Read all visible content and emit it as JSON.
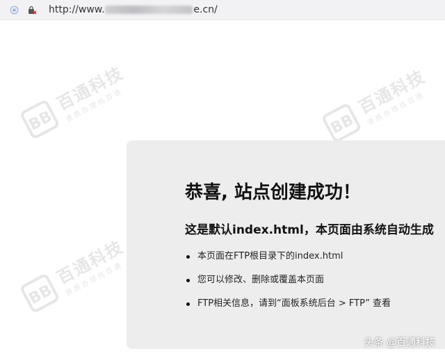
{
  "browser": {
    "url_prefix": "http://www.",
    "url_suffix": "e.cn/"
  },
  "watermark": {
    "name": "百通科技",
    "slogan": "贤质办理找百通",
    "logo_text": "BB"
  },
  "page": {
    "title": "恭喜, 站点创建成功！",
    "subtitle": "这是默认index.html，本页面由系统自动生成",
    "bullets": [
      "本页面在FTP根目录下的index.html",
      "您可以修改、删除或覆盖本页面",
      "FTP相关信息，请到“面板系统后台 > FTP” 查看"
    ]
  },
  "caption": "头条 @百通科技",
  "colors": {
    "card_bg": "#ededee",
    "addr_bg": "#f2f2f4"
  }
}
